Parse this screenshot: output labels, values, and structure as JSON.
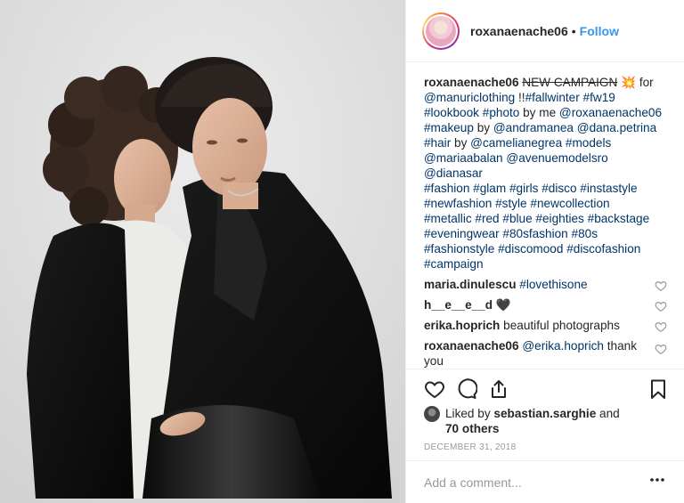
{
  "header": {
    "username": "roxanaenache06",
    "dot": "•",
    "follow_label": "Follow"
  },
  "caption": {
    "username": "roxanaenache06",
    "struck_text": "NEW CAMPAIGN",
    "emoji": "💥",
    "w_for": " for",
    "l2_mention": "@manuriclothing",
    "l2_mid": " !!",
    "l2_tag1": "#fallwinter",
    "l2_tag2": "#fw19",
    "l3_tag1": "#lookbook",
    "l3_tag2": "#photo",
    "l3_by": " by me ",
    "l3_mention": "@roxanaenache06",
    "l4_tag": "#makeup",
    "l4_by": " by ",
    "l4_m1": "@andramanea",
    "l4_m2": "@dana.petrina",
    "l5_tag": "#hair",
    "l5_by": " by ",
    "l5_m1": "@camelianegrea",
    "l5_tag2": "#models",
    "l6_m1": "@mariaabalan",
    "l6_m2": "@avenuemodelsro",
    "l6_m3": "@dianasar",
    "l7": "#fashion #glam #girls #disco #instastyle",
    "l8": "#newfashion #style #newcollection",
    "l9": "#metallic #red #blue #eighties #backstage",
    "l10": "#eveningwear #80sfashion #80s",
    "l11": "#fashionstyle #discomood #discofashion",
    "l12": "#campaign"
  },
  "comments": [
    {
      "user": "maria.dinulescu",
      "text": "#lovethisone"
    },
    {
      "user": "h__e__e__d",
      "text": "🖤"
    },
    {
      "user": "erika.hoprich",
      "text": "beautiful photographs"
    },
    {
      "user": "roxanaenache06",
      "mention": "@erika.hoprich",
      "text": " thank you"
    }
  ],
  "likes": {
    "prefix": "Liked by ",
    "user": "sebastian.sarghie",
    "and": " and",
    "others": "70 others"
  },
  "date": "DECEMBER 31, 2018",
  "add_comment": {
    "placeholder": "Add a comment..."
  },
  "icons": {
    "like": "heart-icon",
    "comment": "comment-bubble-icon",
    "share": "share-icon",
    "save": "bookmark-icon",
    "more": "more-dots-icon"
  },
  "colors": {
    "follow_blue": "#3897f0",
    "link_navy": "#003569",
    "border": "#efefef",
    "muted": "#999999"
  }
}
